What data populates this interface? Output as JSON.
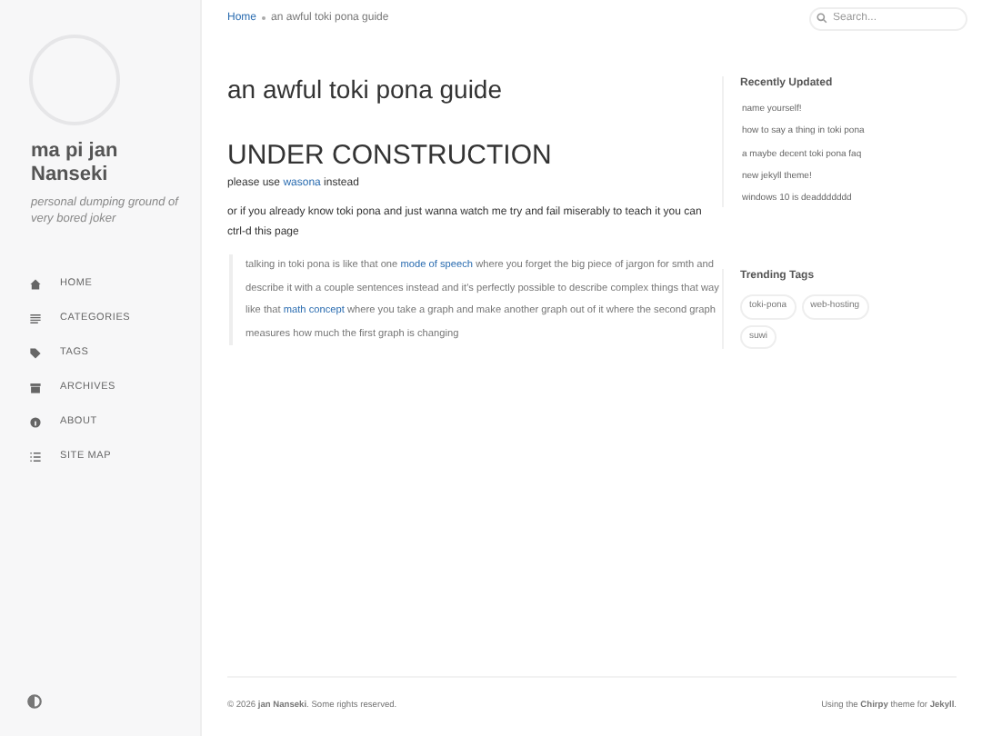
{
  "sidebar": {
    "site_title": "ma pi jan Nanseki",
    "subtitle": "personal dumping ground of very bored joker",
    "nav": [
      {
        "kind": "home",
        "label": "HOME",
        "selected": false
      },
      {
        "kind": "categories",
        "label": "CATEGORIES",
        "selected": false
      },
      {
        "kind": "tags",
        "label": "TAGS",
        "selected": false
      },
      {
        "kind": "archives",
        "label": "ARCHIVES",
        "selected": false
      },
      {
        "kind": "about",
        "label": "ABOUT",
        "selected": false
      },
      {
        "kind": "sitemap",
        "label": "SITE MAP",
        "selected": false
      }
    ]
  },
  "breadcrumb": [
    {
      "label": "Home",
      "link": true
    },
    {
      "label": "an awful toki pona guide",
      "link": false
    }
  ],
  "search": {
    "placeholder": "Search..."
  },
  "post": {
    "title": "an awful toki pona guide",
    "heading": "UNDER CONSTRUCTION",
    "paragraphs": [
      [
        {
          "text": "please use ",
          "link": false
        },
        {
          "text": "wasona",
          "link": true
        },
        {
          "text": " instead",
          "link": false
        }
      ],
      [
        {
          "text": "or if you already know toki pona and just wanna watch me try and fail miserably to teach it you can ctrl-d this page",
          "link": false
        }
      ]
    ],
    "quote": [
      {
        "text": "talking in toki pona is like that one ",
        "link": false
      },
      {
        "text": "mode of speech",
        "link": true
      },
      {
        "text": " where you forget the big piece of jargon for smth and describe it with a couple sentences instead and it's perfectly possible to describe complex things that way like that ",
        "link": false
      },
      {
        "text": "math concept",
        "link": true
      },
      {
        "text": " where you take a graph and make another graph out of it where the second graph measures how much the first graph is changing",
        "link": false
      }
    ]
  },
  "recently_updated": {
    "title": "Recently Updated",
    "items": [
      "name yourself!",
      "how to say a thing in toki pona",
      "a maybe decent toki pona faq",
      "new jekyll theme!",
      "windows 10 is deaddddddd"
    ]
  },
  "trending_tags": {
    "title": "Trending Tags",
    "tags": [
      "toki-pona",
      "web-hosting",
      "suwi"
    ]
  },
  "footer": {
    "copyright": "© 2026 **jan Nanseki**. Some rights reserved.",
    "credit": "Using the **Chirpy** theme for **Jekyll**."
  }
}
